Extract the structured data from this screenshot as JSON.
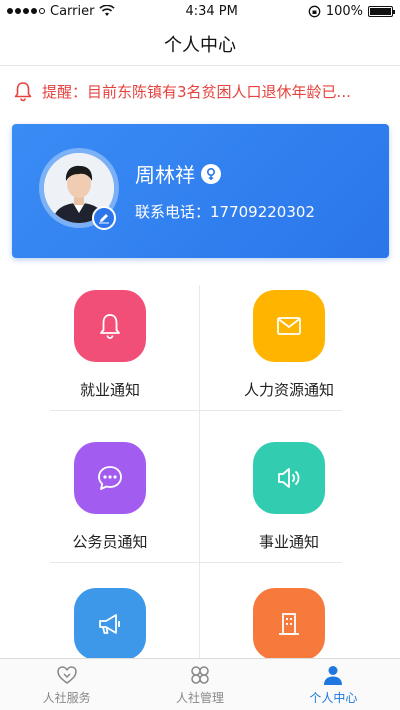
{
  "status_bar": {
    "carrier": "Carrier",
    "time": "4:34 PM",
    "battery": "100%"
  },
  "header": {
    "title": "个人中心"
  },
  "notice": {
    "text": "提醒：目前东陈镇有3名贫困人口退休年龄已..."
  },
  "profile": {
    "name": "周林祥",
    "phone": "联系电话：17709220302"
  },
  "menu": [
    {
      "label": "就业通知",
      "icon": "bell-icon",
      "color": "#f24f78"
    },
    {
      "label": "人力资源通知",
      "icon": "mail-icon",
      "color": "#ffb400"
    },
    {
      "label": "公务员通知",
      "icon": "chat-icon",
      "color": "#a25cf0"
    },
    {
      "label": "事业通知",
      "icon": "speaker-icon",
      "color": "#32cdb0"
    },
    {
      "label": "",
      "icon": "megaphone-icon",
      "color": "#3d98ea"
    },
    {
      "label": "",
      "icon": "building-icon",
      "color": "#f57a3c"
    }
  ],
  "tabs": [
    {
      "label": "人社服务",
      "icon": "heart-icon",
      "active": false
    },
    {
      "label": "人社管理",
      "icon": "clover-icon",
      "active": false
    },
    {
      "label": "个人中心",
      "icon": "person-icon",
      "active": true
    }
  ],
  "colors": {
    "primary": "#2a76ea",
    "alert": "#e5433f"
  }
}
